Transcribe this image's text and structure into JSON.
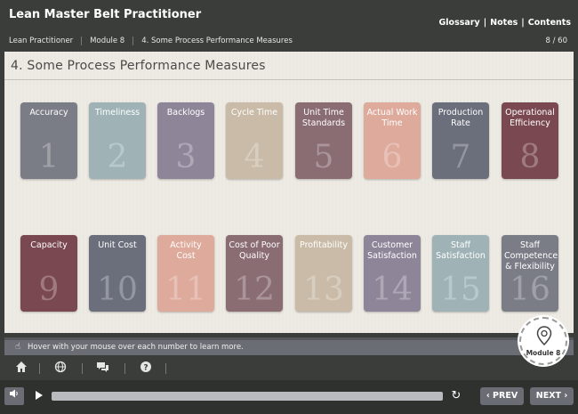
{
  "app": {
    "title": "Lean Master Belt Practitioner",
    "links": [
      "Glossary",
      "Notes",
      "Contents"
    ],
    "link_separator": "|"
  },
  "breadcrumb": [
    "Lean Practitioner",
    "Module 8",
    "4. Some Process Performance Measures"
  ],
  "page_counter": "8 / 60",
  "page": {
    "title": "4. Some Process Performance Measures"
  },
  "tiles": [
    {
      "label": "Accuracy",
      "number": "1",
      "color": "#7a7d86"
    },
    {
      "label": "Timeliness",
      "number": "2",
      "color": "#9fb3b6"
    },
    {
      "label": "Backlogs",
      "number": "3",
      "color": "#8f8599"
    },
    {
      "label": "Cycle Time",
      "number": "4",
      "color": "#c9bba7"
    },
    {
      "label": "Unit Time Standards",
      "number": "5",
      "color": "#8a6c73"
    },
    {
      "label": "Actual Work Time",
      "number": "6",
      "color": "#deaa9c"
    },
    {
      "label": "Production Rate",
      "number": "7",
      "color": "#6b6f7c"
    },
    {
      "label": "Operational Efficiency",
      "number": "8",
      "color": "#7a4850"
    },
    {
      "label": "Capacity",
      "number": "9",
      "color": "#7a4850"
    },
    {
      "label": "Unit Cost",
      "number": "10",
      "color": "#6b6f7c"
    },
    {
      "label": "Activity Cost",
      "number": "11",
      "color": "#deaa9c"
    },
    {
      "label": "Cost of Poor Quality",
      "number": "12",
      "color": "#8a6c73"
    },
    {
      "label": "Profitability",
      "number": "13",
      "color": "#c9bba7"
    },
    {
      "label": "Customer Satisfaction",
      "number": "14",
      "color": "#8f8599"
    },
    {
      "label": "Staff Satisfaction",
      "number": "15",
      "color": "#9fb3b6"
    },
    {
      "label": "Staff Competence & Flexibility",
      "number": "16",
      "color": "#7a7d86"
    }
  ],
  "instruction": "Hover with your mouse over each number to learn more.",
  "badge": {
    "label": "Module 8"
  },
  "player": {
    "prev_label": "PREV",
    "next_label": "NEXT",
    "progress": 0.0
  }
}
